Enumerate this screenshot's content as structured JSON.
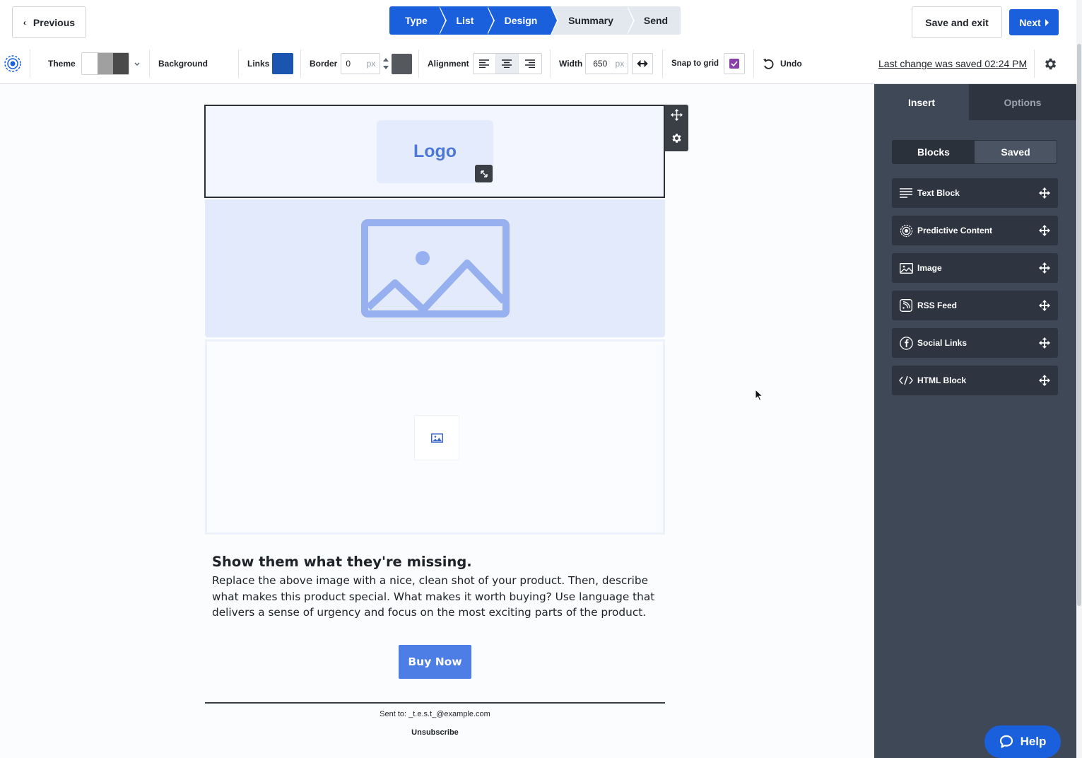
{
  "header": {
    "previous_label": "Previous",
    "steps": [
      {
        "label": "Type",
        "state": "done"
      },
      {
        "label": "List",
        "state": "done"
      },
      {
        "label": "Design",
        "state": "current"
      },
      {
        "label": "Summary",
        "state": "todo"
      },
      {
        "label": "Send",
        "state": "todo"
      }
    ],
    "save_exit_label": "Save and exit",
    "next_label": "Next"
  },
  "toolbar": {
    "theme_label": "Theme",
    "theme_colors": [
      "#ffffff",
      "#a0a0a0",
      "#4a4a4a"
    ],
    "background_label": "Background",
    "links_label": "Links",
    "links_color": "#1a55b0",
    "border_label": "Border",
    "border_value": "0",
    "border_unit": "px",
    "border_color": "#55585d",
    "alignment_label": "Alignment",
    "alignment_selected": "center",
    "width_label": "Width",
    "width_value": "650",
    "width_unit": "px",
    "snap_label": "Snap to grid",
    "snap_checked": true,
    "undo_label": "Undo",
    "saved_status": "Last change was saved 02:24 PM"
  },
  "email": {
    "logo_text": "Logo",
    "headline": "Show them what they're missing.",
    "body": "Replace the above image with a nice, clean shot of your product. Then, describe what makes this product special. What makes it worth buying? Use language that delivers a sense of urgency and focus on the most exciting parts of the product.",
    "button_label": "Buy Now",
    "sent_to": "Sent to: _t.e.s.t_@example.com",
    "unsubscribe": "Unsubscribe"
  },
  "panel": {
    "tabs": [
      {
        "label": "Insert",
        "active": true
      },
      {
        "label": "Options",
        "active": false
      }
    ],
    "segments": [
      {
        "label": "Blocks",
        "active": true
      },
      {
        "label": "Saved",
        "active": false
      }
    ],
    "blocks": [
      {
        "label": "Text Block",
        "icon": "text-lines-icon"
      },
      {
        "label": "Predictive Content",
        "icon": "target-icon"
      },
      {
        "label": "Image",
        "icon": "image-icon"
      },
      {
        "label": "RSS Feed",
        "icon": "rss-icon"
      },
      {
        "label": "Social Links",
        "icon": "facebook-icon"
      },
      {
        "label": "HTML Block",
        "icon": "code-icon"
      }
    ]
  },
  "help_label": "Help",
  "colors": {
    "accent": "#1a5fdc",
    "panel_bg": "#3f4856",
    "block_bg": "#2e3540",
    "buy_button": "#4d7ee6"
  }
}
